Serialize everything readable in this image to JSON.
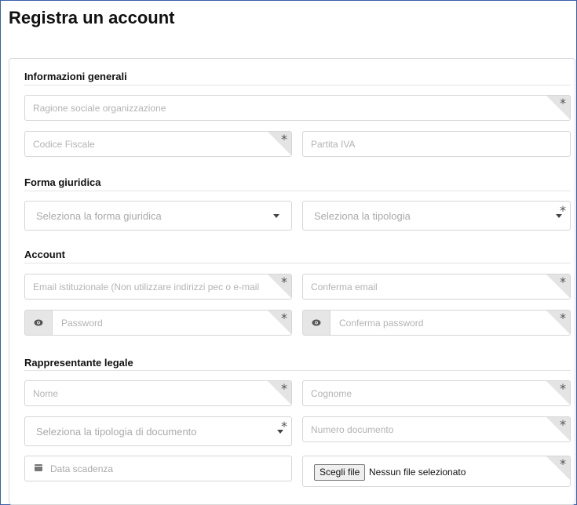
{
  "page": {
    "title": "Registra un account"
  },
  "sections": {
    "general": "Informazioni generali",
    "legal_form": "Forma giuridica",
    "account": "Account",
    "legal_rep": "Rappresentante legale"
  },
  "fields": {
    "company_name": {
      "placeholder": "Ragione sociale organizzazione",
      "required": true
    },
    "tax_code": {
      "placeholder": "Codice Fiscale",
      "required": true
    },
    "vat_number": {
      "placeholder": "Partita IVA",
      "required": false
    },
    "legal_form_select": {
      "placeholder": "Seleziona la forma giuridica"
    },
    "type_select": {
      "placeholder": "Seleziona la tipologia",
      "required": true
    },
    "email": {
      "placeholder": "Email istituzionale (Non utilizzare indirizzi pec o e-mail",
      "required": true
    },
    "confirm_email": {
      "placeholder": "Conferma email",
      "required": true
    },
    "password": {
      "placeholder": "Password",
      "required": true
    },
    "confirm_password": {
      "placeholder": "Conferma password",
      "required": true
    },
    "first_name": {
      "placeholder": "Nome",
      "required": true
    },
    "last_name": {
      "placeholder": "Cognome",
      "required": true
    },
    "document_type_select": {
      "placeholder": "Seleziona la tipologia di documento",
      "required": true
    },
    "document_number": {
      "placeholder": "Numero documento",
      "required": true
    },
    "expiry_date": {
      "placeholder": "Data scadenza"
    },
    "file": {
      "button_label": "Scegli file",
      "status": "Nessun file selezionato",
      "required": true
    }
  },
  "required_marker": "*",
  "icons": {
    "eye": "eye-icon",
    "calendar": "calendar-icon",
    "caret": "chevron-down-icon"
  }
}
